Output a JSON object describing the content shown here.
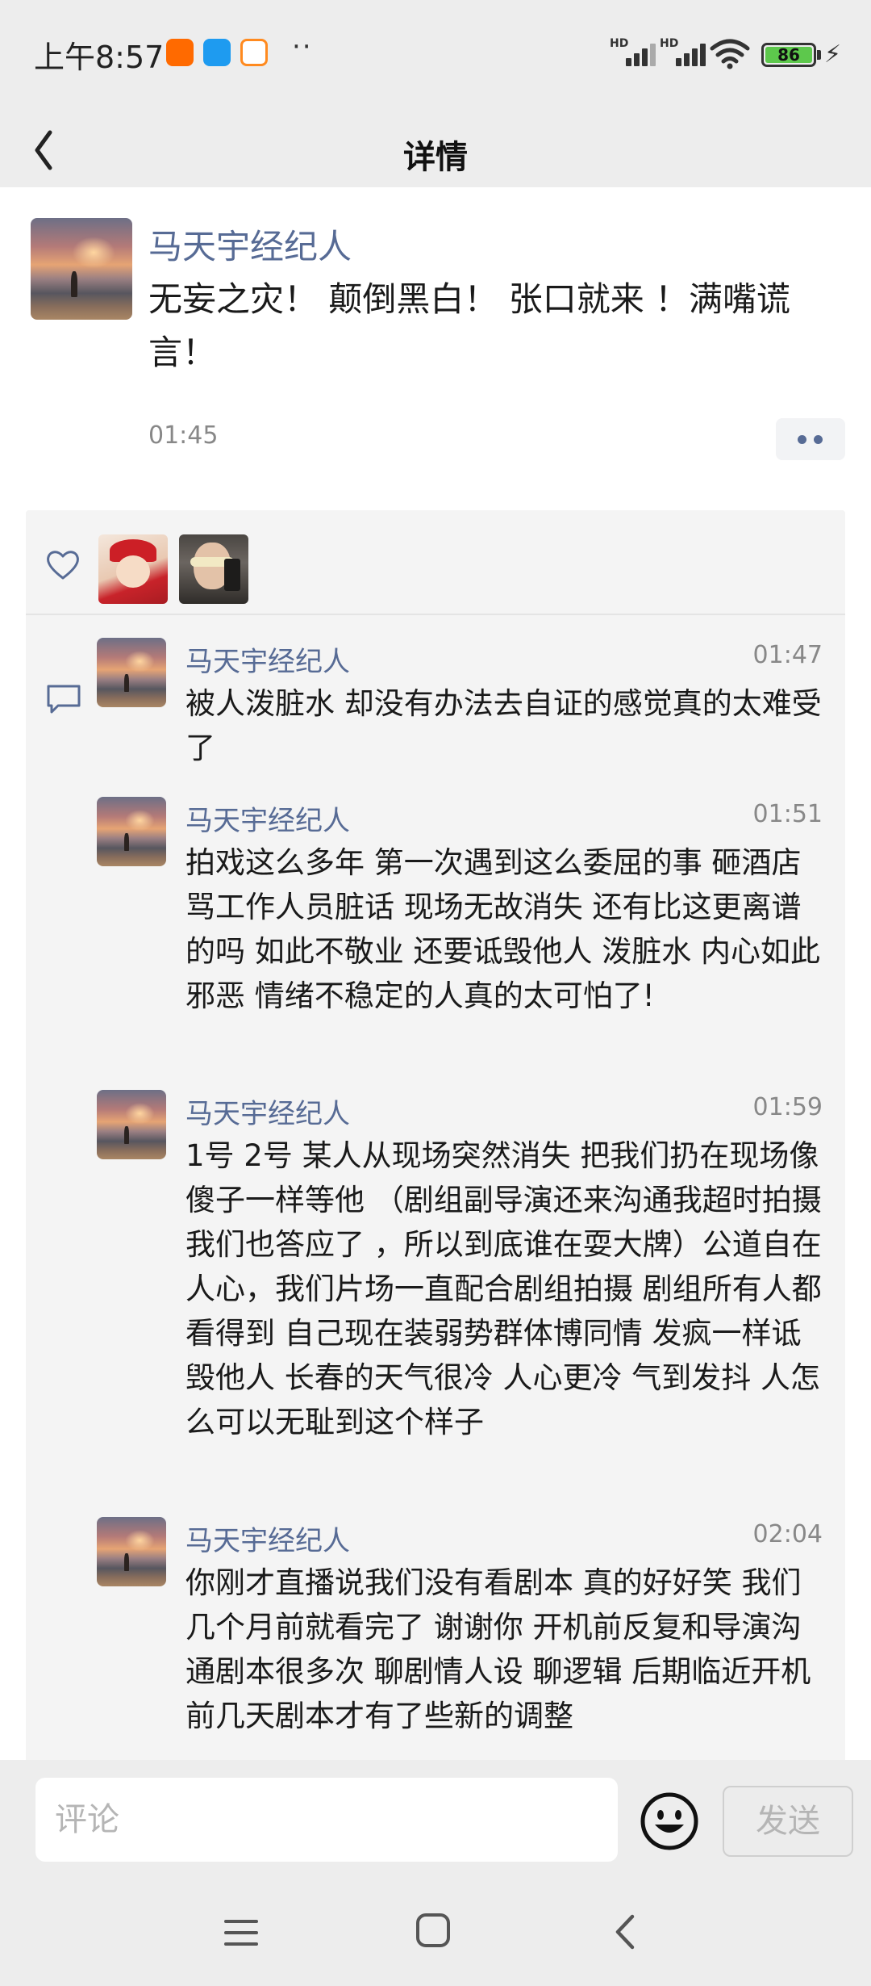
{
  "status_bar": {
    "time": "上午8:57",
    "dots": "··",
    "battery": "86",
    "signal_label": "HD"
  },
  "nav": {
    "title": "详情"
  },
  "post": {
    "author": "马天宇经纪人",
    "text": "无妄之灾！ 颠倒黑白！ 张口就来 ！满嘴谎言！",
    "time": "01:45"
  },
  "comments": [
    {
      "author": "马天宇经纪人",
      "time": "01:47",
      "text": "被人泼脏水 却没有办法去自证的感觉真的太难受了"
    },
    {
      "author": "马天宇经纪人",
      "time": "01:51",
      "text": "拍戏这么多年 第一次遇到这么委屈的事 砸酒店 骂工作人员脏话 现场无故消失 还有比这更离谱的吗  如此不敬业 还要诋毁他人 泼脏水 内心如此邪恶  情绪不稳定的人真的太可怕了!"
    },
    {
      "author": "马天宇经纪人",
      "time": "01:59",
      "text": "1号 2号 某人从现场突然消失 把我们扔在现场像傻子一样等他 （剧组副导演还来沟通我超时拍摄 我们也答应了 ，所以到底谁在耍大牌）公道自在人心，我们片场一直配合剧组拍摄  剧组所有人都看得到  自己现在装弱势群体博同情 发疯一样诋毁他人  长春的天气很冷  人心更冷  气到发抖  人怎么可以无耻到这个样子"
    },
    {
      "author": "马天宇经纪人",
      "time": "02:04",
      "text": "你刚才直播说我们没有看剧本  真的好好笑  我们几个月前就看完了 谢谢你  开机前反复和导演沟通剧本很多次   聊剧情人设  聊逻辑  后期临近开机前几天剧本才有了些新的调整"
    }
  ],
  "input": {
    "placeholder": "评论",
    "send_label": "发送"
  },
  "icons": {
    "back": "chevron-left-icon",
    "more": "more-dots-icon",
    "like": "heart-icon",
    "comment": "comment-bubble-icon",
    "emoji": "smiley-icon"
  },
  "colors": {
    "link_blue": "#576b95",
    "background": "#ededed",
    "battery_green": "#5dc84c"
  }
}
